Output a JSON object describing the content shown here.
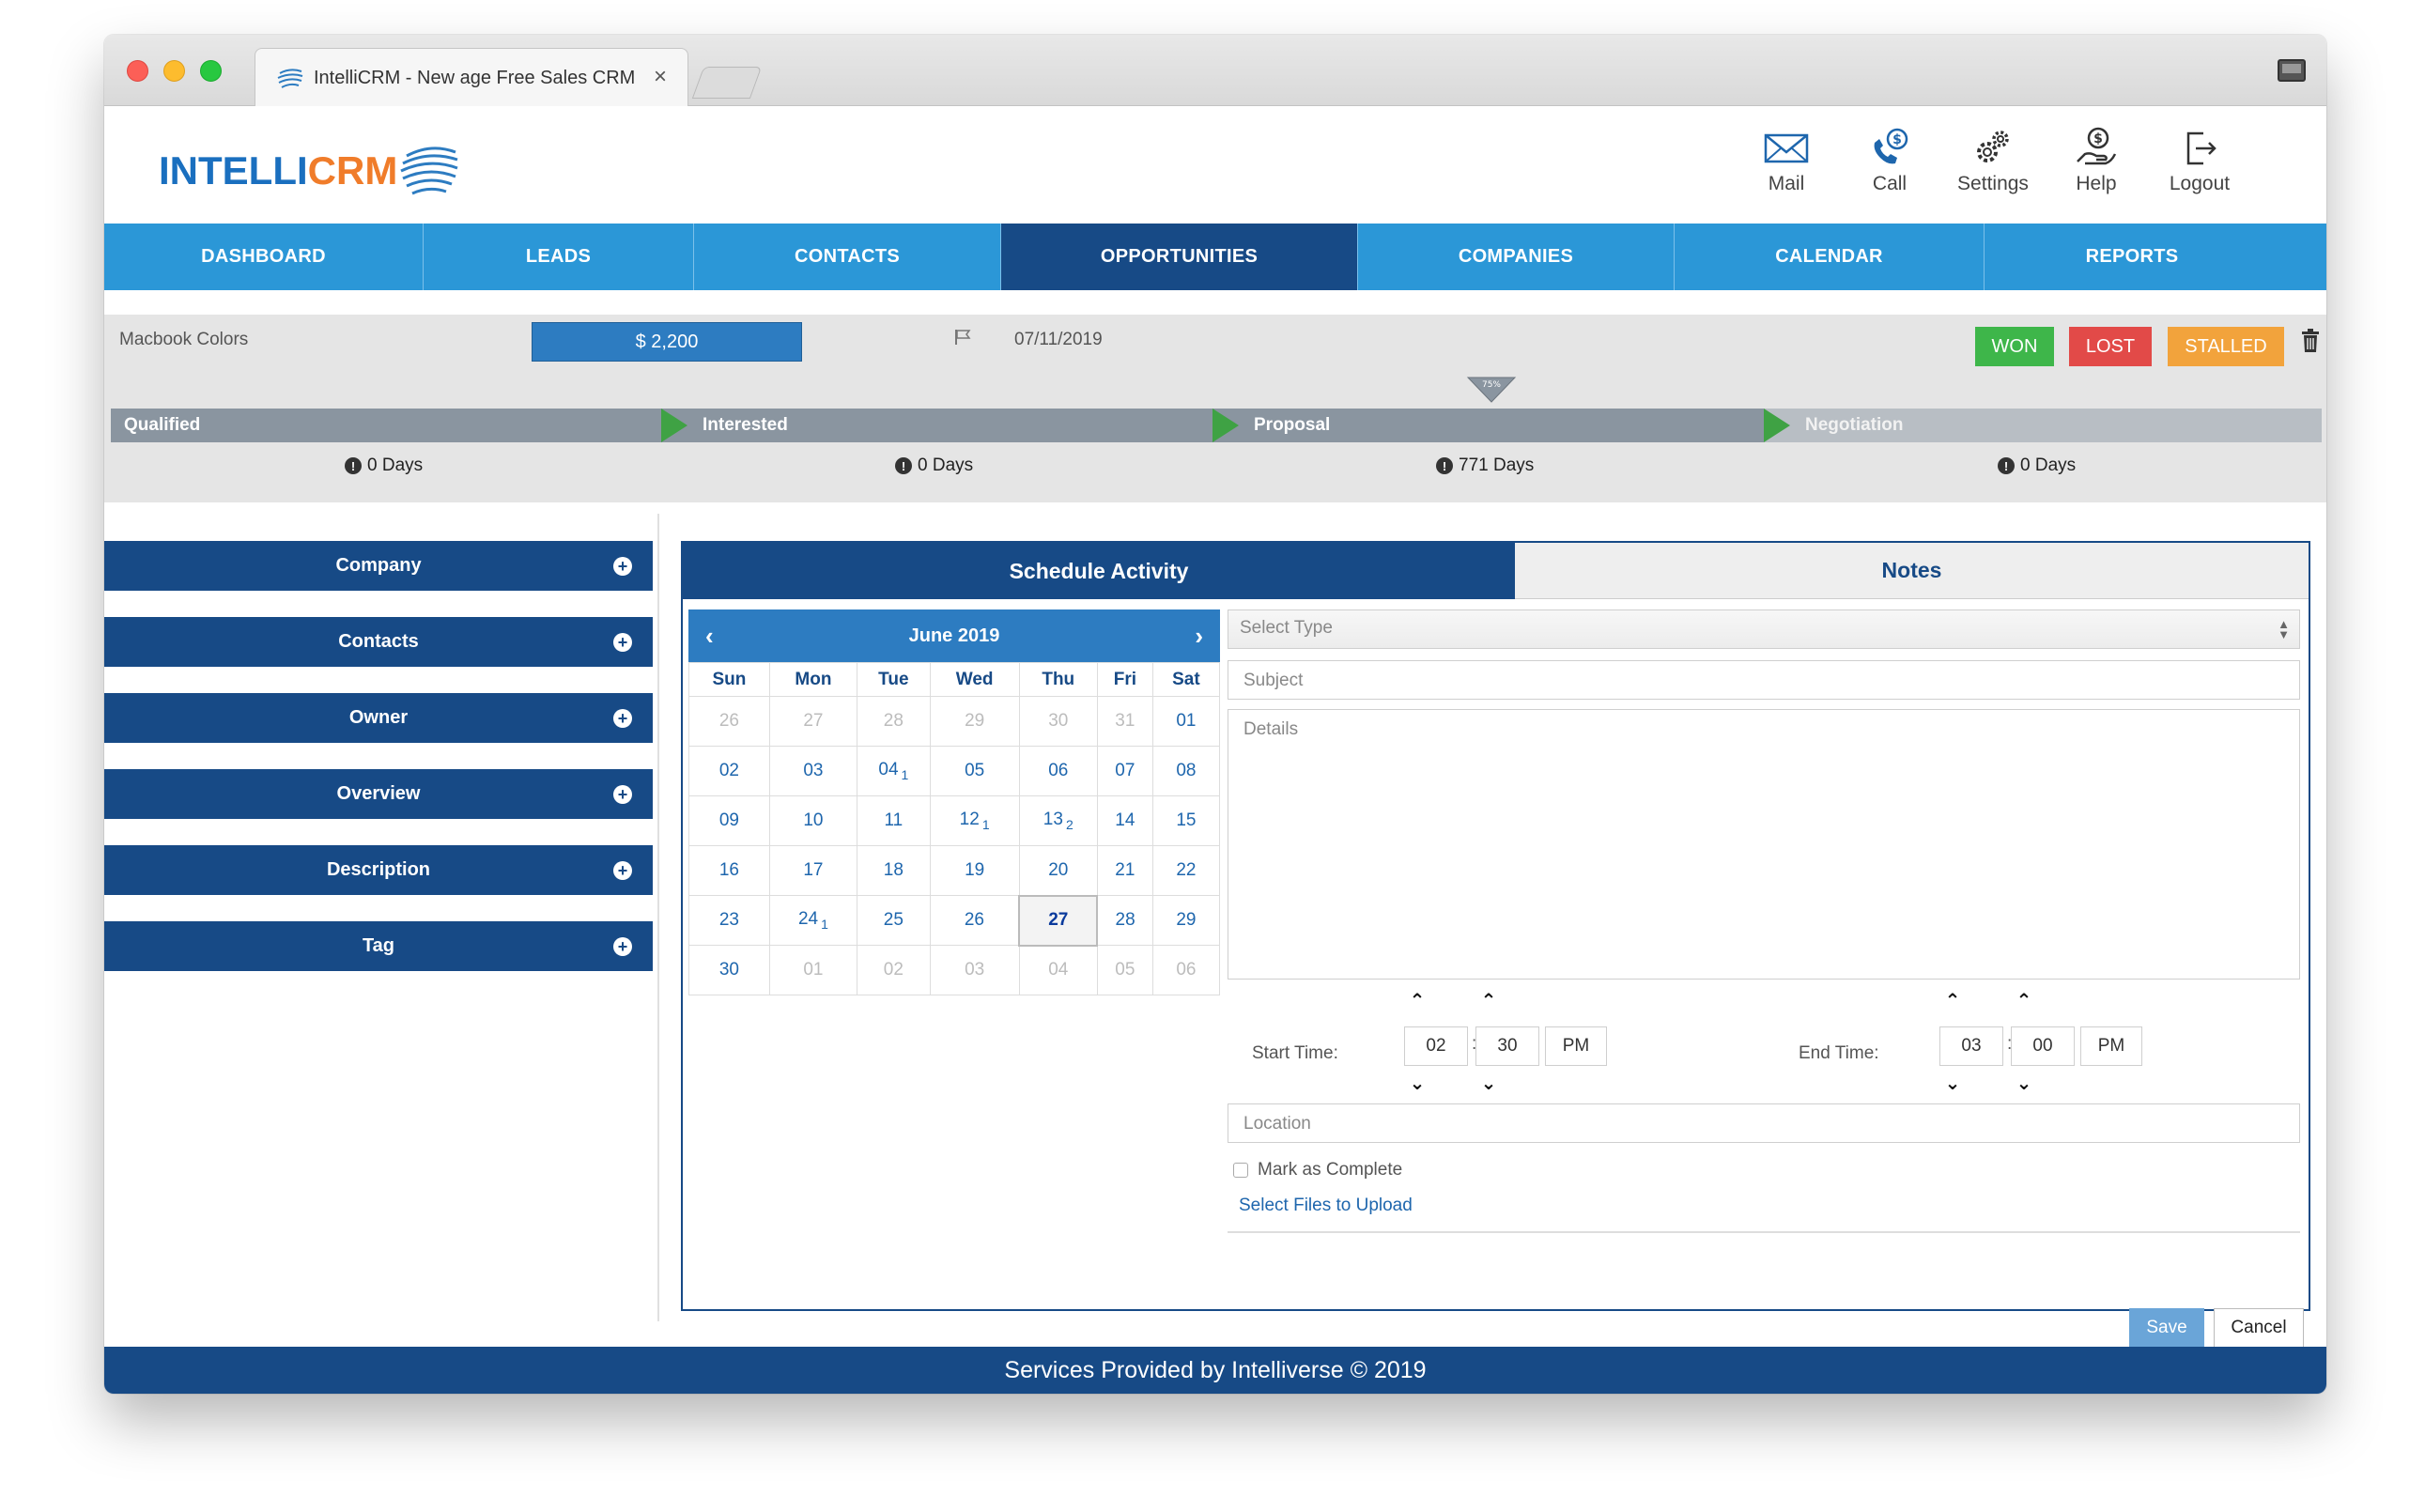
{
  "browser": {
    "tab_title": "IntelliCRM - New age Free Sales CRM",
    "tab_close": "×"
  },
  "brand": {
    "logo_part1": "INTELLI",
    "logo_part2": "CRM",
    "primary_color": "#174a86",
    "accent_color": "#2b97d7",
    "logo_orange": "#f07c2a"
  },
  "top_actions": [
    {
      "label": "Mail",
      "icon": "mail-icon"
    },
    {
      "label": "Call",
      "icon": "phone-dollar-icon"
    },
    {
      "label": "Settings",
      "icon": "gears-icon"
    },
    {
      "label": "Help",
      "icon": "help-hand-icon"
    },
    {
      "label": "Logout",
      "icon": "logout-icon"
    }
  ],
  "nav": {
    "items": [
      {
        "label": "DASHBOARD"
      },
      {
        "label": "LEADS"
      },
      {
        "label": "CONTACTS"
      },
      {
        "label": "OPPORTUNITIES",
        "active": true
      },
      {
        "label": "COMPANIES"
      },
      {
        "label": "CALENDAR"
      },
      {
        "label": "REPORTS"
      }
    ]
  },
  "opportunity": {
    "name": "Macbook Colors",
    "amount": "$ 2,200",
    "close_date": "07/11/2019",
    "progress_label": "75%",
    "buttons": {
      "won": "WON",
      "lost": "LOST",
      "stalled": "STALLED"
    },
    "stages": [
      {
        "label": "Qualified",
        "days": "0 Days"
      },
      {
        "label": "Interested",
        "days": "0 Days"
      },
      {
        "label": "Proposal",
        "days": "771 Days"
      },
      {
        "label": "Negotiation",
        "days": "0 Days"
      }
    ],
    "alert_glyph": "!"
  },
  "accordion": {
    "items": [
      {
        "label": "Company"
      },
      {
        "label": "Contacts"
      },
      {
        "label": "Owner"
      },
      {
        "label": "Overview"
      },
      {
        "label": "Description"
      },
      {
        "label": "Tag"
      }
    ],
    "expand_glyph": "+"
  },
  "panel": {
    "tabs": {
      "schedule": "Schedule Activity",
      "notes": "Notes"
    }
  },
  "calendar": {
    "month": "June 2019",
    "prev": "‹",
    "next": "›",
    "weekdays": [
      "Sun",
      "Mon",
      "Tue",
      "Wed",
      "Thu",
      "Fri",
      "Sat"
    ],
    "weeks": [
      [
        {
          "d": "26",
          "m": true
        },
        {
          "d": "27",
          "m": true
        },
        {
          "d": "28",
          "m": true
        },
        {
          "d": "29",
          "m": true
        },
        {
          "d": "30",
          "m": true
        },
        {
          "d": "31",
          "m": true
        },
        {
          "d": "01"
        }
      ],
      [
        {
          "d": "02"
        },
        {
          "d": "03"
        },
        {
          "d": "04",
          "c": "1"
        },
        {
          "d": "05"
        },
        {
          "d": "06"
        },
        {
          "d": "07"
        },
        {
          "d": "08"
        }
      ],
      [
        {
          "d": "09"
        },
        {
          "d": "10"
        },
        {
          "d": "11"
        },
        {
          "d": "12",
          "c": "1"
        },
        {
          "d": "13",
          "c": "2"
        },
        {
          "d": "14"
        },
        {
          "d": "15"
        }
      ],
      [
        {
          "d": "16"
        },
        {
          "d": "17"
        },
        {
          "d": "18"
        },
        {
          "d": "19"
        },
        {
          "d": "20"
        },
        {
          "d": "21"
        },
        {
          "d": "22"
        }
      ],
      [
        {
          "d": "23"
        },
        {
          "d": "24",
          "c": "1"
        },
        {
          "d": "25"
        },
        {
          "d": "26"
        },
        {
          "d": "27",
          "t": true
        },
        {
          "d": "28"
        },
        {
          "d": "29"
        }
      ],
      [
        {
          "d": "30"
        },
        {
          "d": "01",
          "m": true
        },
        {
          "d": "02",
          "m": true
        },
        {
          "d": "03",
          "m": true
        },
        {
          "d": "04",
          "m": true
        },
        {
          "d": "05",
          "m": true
        },
        {
          "d": "06",
          "m": true
        }
      ]
    ]
  },
  "form": {
    "select_type_placeholder": "Select Type",
    "subject_placeholder": "Subject",
    "details_placeholder": "Details",
    "start_time": {
      "label": "Start Time:",
      "hour": "02",
      "minute": "30",
      "ampm": "PM"
    },
    "end_time": {
      "label": "End Time:",
      "hour": "03",
      "minute": "00",
      "ampm": "PM"
    },
    "location_placeholder": "Location",
    "mark_complete": "Mark as Complete",
    "upload_link": "Select Files to Upload",
    "save": "Save",
    "cancel": "Cancel",
    "up_glyph": "⌃",
    "down_glyph": "⌄",
    "colon": ":"
  },
  "footer": {
    "text": "Services Provided by Intelliverse © 2019"
  }
}
